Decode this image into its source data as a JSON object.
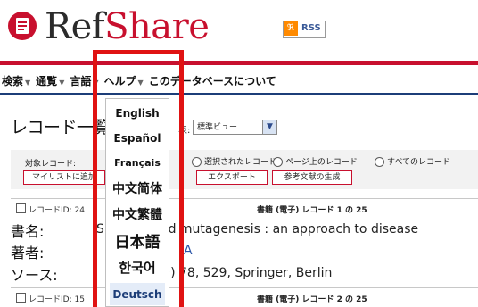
{
  "brand": {
    "ref": "Ref",
    "share": "Share",
    "rss_label": "RSS"
  },
  "nav": {
    "items": [
      {
        "label": "検索",
        "caret": "▼"
      },
      {
        "label": "通覧",
        "caret": "▼"
      },
      {
        "label": "言語",
        "caret": "▼"
      },
      {
        "label": "ヘルプ",
        "caret": "▼"
      },
      {
        "label": "このデータベースについて",
        "caret": ""
      }
    ]
  },
  "content": {
    "record_title": "レコード一覧",
    "view_label": "表:",
    "view_select": "標準ビュー",
    "target_label": "対象レコード:",
    "radio_options": [
      "選択されたレコード",
      "ページ上のレコード",
      "すべてのレコード"
    ],
    "buttons": [
      "マイリストに追加",
      "エクスポート",
      "参考文献の生成"
    ]
  },
  "records": [
    {
      "id_label": "レコードID: 24",
      "count_label": "書籍 (電子) レコード 1 の 25",
      "title_label": "書名:",
      "title_value": "Site-directed mutagenesis : an approach to disease",
      "author_label": "著者:",
      "author_value": "A",
      "source_label": "ソース:",
      "source_value": "(1999) 78, 529, Springer, Berlin"
    },
    {
      "id_label": "レコードID: 15",
      "count_label": "書籍 (電子) レコード 2 の 25"
    }
  ],
  "language_menu": {
    "items": [
      {
        "label": "English",
        "size": 12
      },
      {
        "label": "Español",
        "size": 12
      },
      {
        "label": "Français",
        "size": 11
      },
      {
        "label": "中文简体",
        "size": 14
      },
      {
        "label": "中文繁體",
        "size": 14
      },
      {
        "label": "日本語",
        "size": 17
      },
      {
        "label": "한국어",
        "size": 15
      },
      {
        "label": "Deutsch",
        "size": 12
      }
    ],
    "selected_index": 7
  },
  "colors": {
    "accent_red": "#c8102e",
    "navy": "#1c3d78",
    "highlight": "#e01212"
  }
}
